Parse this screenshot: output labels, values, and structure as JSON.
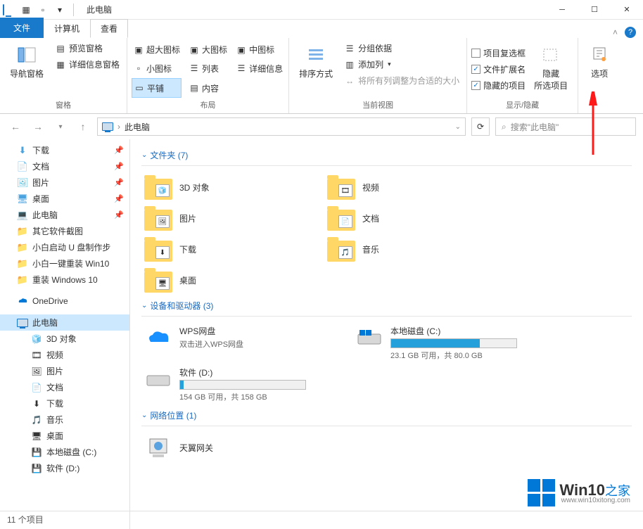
{
  "title": "此电脑",
  "tabs": {
    "file": "文件",
    "computer": "计算机",
    "view": "查看"
  },
  "ribbon": {
    "pane": {
      "nav": "导航窗格",
      "preview": "预览窗格",
      "details": "详细信息窗格",
      "label": "窗格"
    },
    "layout": {
      "xl": "超大图标",
      "lg": "大图标",
      "md": "中图标",
      "sm": "小图标",
      "list": "列表",
      "detail": "详细信息",
      "tile": "平铺",
      "content": "内容",
      "label": "布局"
    },
    "sort": {
      "sort": "排序方式",
      "group": "分组依据",
      "addcol": "添加列",
      "fit": "将所有列调整为合适的大小",
      "label": "当前视图"
    },
    "show": {
      "itemcb": "项目复选框",
      "ext": "文件扩展名",
      "hidden": "隐藏的项目",
      "hidesel": "隐藏\n所选项目",
      "options": "选项",
      "label": "显示/隐藏"
    }
  },
  "addr": {
    "path": "此电脑",
    "searchPlaceholder": "搜索\"此电脑\""
  },
  "sidebar": {
    "quickAccess": [
      {
        "label": "下载",
        "pin": true
      },
      {
        "label": "文档",
        "pin": true
      },
      {
        "label": "图片",
        "pin": true
      },
      {
        "label": "桌面",
        "pin": true
      },
      {
        "label": "此电脑",
        "pin": true
      },
      {
        "label": "其它软件截图",
        "pin": false
      },
      {
        "label": "小白启动 U 盘制作步",
        "pin": false
      },
      {
        "label": "小白一键重装 Win10",
        "pin": false
      },
      {
        "label": "重装 Windows 10",
        "pin": false
      }
    ],
    "onedrive": "OneDrive",
    "thispc": "此电脑",
    "thispcItems": [
      {
        "label": "3D 对象"
      },
      {
        "label": "视频"
      },
      {
        "label": "图片"
      },
      {
        "label": "文档"
      },
      {
        "label": "下载"
      },
      {
        "label": "音乐"
      },
      {
        "label": "桌面"
      },
      {
        "label": "本地磁盘 (C:)"
      },
      {
        "label": "软件 (D:)"
      }
    ]
  },
  "content": {
    "foldersHeader": "文件夹 (7)",
    "folders": [
      {
        "label": "3D 对象"
      },
      {
        "label": "视频"
      },
      {
        "label": "图片"
      },
      {
        "label": "文档"
      },
      {
        "label": "下载"
      },
      {
        "label": "音乐"
      },
      {
        "label": "桌面"
      }
    ],
    "drivesHeader": "设备和驱动器 (3)",
    "drives": {
      "wps": {
        "name": "WPS网盘",
        "sub": "双击进入WPS网盘"
      },
      "c": {
        "name": "本地磁盘 (C:)",
        "sub": "23.1 GB 可用，共 80.0 GB",
        "pct": 71
      },
      "d": {
        "name": "软件 (D:)",
        "sub": "154 GB 可用，共 158 GB",
        "pct": 3
      }
    },
    "networkHeader": "网络位置 (1)",
    "network": {
      "name": "天翼网关"
    }
  },
  "status": "11 个项目",
  "watermark": {
    "big": "Win10",
    "suffix": "之家",
    "url": "www.win10xitong.com"
  }
}
